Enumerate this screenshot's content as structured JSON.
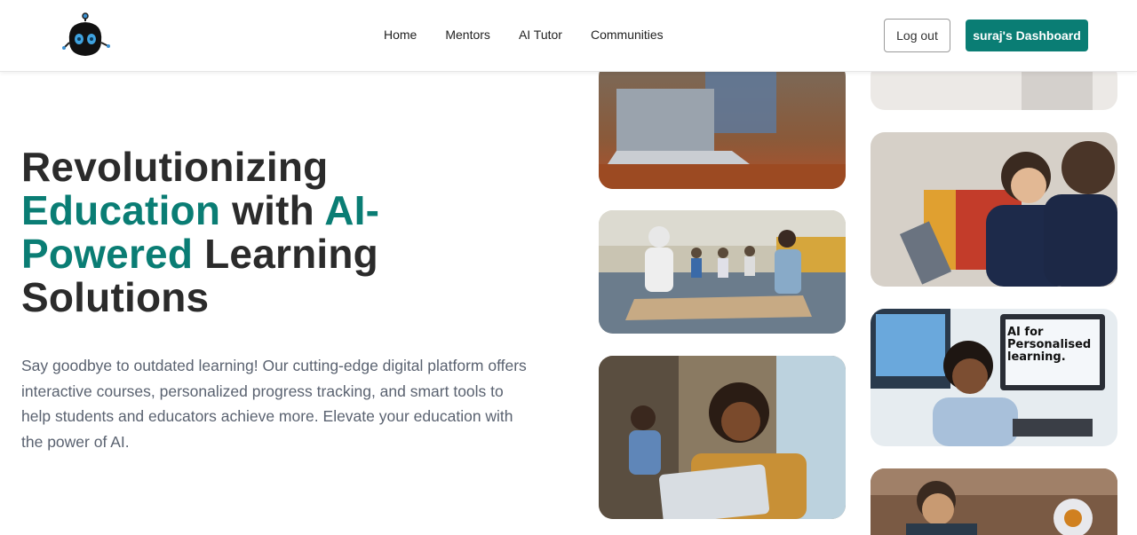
{
  "header": {
    "logo_icon": "robot-logo-icon",
    "nav": [
      "Home",
      "Mentors",
      "AI Tutor",
      "Communities"
    ],
    "logout_label": "Log out",
    "dashboard_label": "suraj's Dashboard",
    "accent_color": "#0a7d74"
  },
  "hero": {
    "title_part1": "Revolutionizing",
    "title_accent1": "Education",
    "title_part2": " with ",
    "title_accent2": "AI-",
    "title_accent3": "Powered",
    "title_part3": " Learning",
    "title_part4": "Solutions",
    "description": "Say goodbye to outdated learning! Our cutting-edge digital platform offers interactive courses, personalized progress tracking, and smart tools to help students and educators achieve more. Elevate your education with the power of AI."
  },
  "gallery": {
    "monitor_caption": "AI for Personalised learning."
  }
}
